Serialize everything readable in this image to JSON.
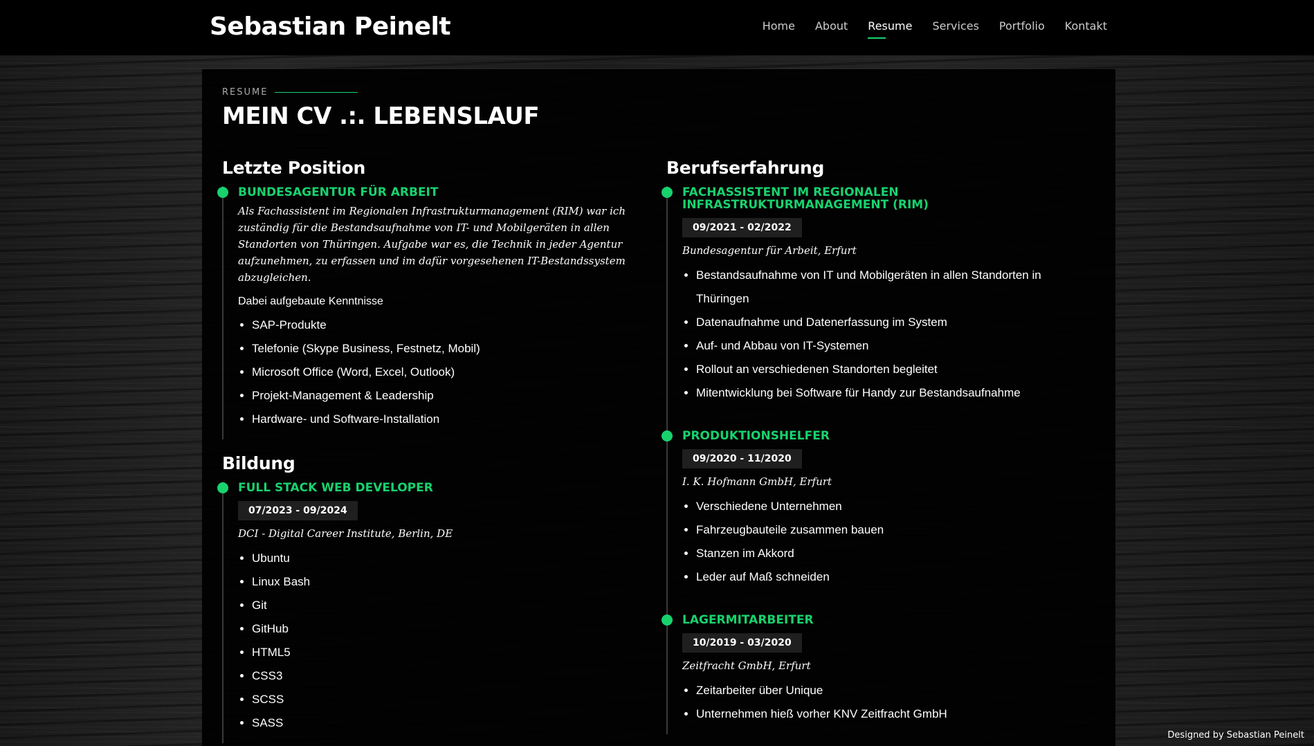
{
  "header": {
    "logo": "Sebastian Peinelt",
    "nav": [
      "Home",
      "About",
      "Resume",
      "Services",
      "Portfolio",
      "Kontakt"
    ],
    "active_nav": "Resume"
  },
  "section": {
    "kicker": "RESUME",
    "title": "MEIN CV .:. LEBENSLAUF"
  },
  "left": {
    "position_heading": "Letzte Position",
    "position": {
      "title": "BUNDESAGENTUR FÜR ARBEIT",
      "description": "Als Fachassistent im Regionalen Infrastrukturmanagement (RIM) war ich zuständig für die Bestandsaufnahme von IT- und Mobilgeräten in allen Standorten von Thüringen. Aufgabe war es, die Technik in jeder Agentur aufzunehmen, zu erfassen und im dafür vorgesehenen IT-Bestandssystem abzugleichen.",
      "skills_label": "Dabei aufgebaute Kenntnisse",
      "skills": [
        "SAP-Produkte",
        "Telefonie (Skype Business, Festnetz, Mobil)",
        "Microsoft Office (Word, Excel, Outlook)",
        "Projekt-Management & Leadership",
        "Hardware- und Software-Installation"
      ]
    },
    "education_heading": "Bildung",
    "education": {
      "title": "FULL STACK WEB DEVELOPER",
      "date": "07/2023 - 09/2024",
      "org": "DCI - Digital Career Institute, Berlin, DE",
      "items": [
        "Ubuntu",
        "Linux Bash",
        "Git",
        "GitHub",
        "HTML5",
        "CSS3",
        "SCSS",
        "SASS"
      ]
    }
  },
  "right": {
    "heading": "Berufserfahrung",
    "jobs": [
      {
        "title": "FACHASSISTENT IM REGIONALEN INFRASTRUKTURMANAGEMENT (RIM)",
        "date": "09/2021 - 02/2022",
        "org": "Bundesagentur für Arbeit, Erfurt",
        "items": [
          "Bestandsaufnahme von IT und Mobilgeräten in allen Standorten in Thüringen",
          "Datenaufnahme und Datenerfassung im System",
          "Auf- und Abbau von IT-Systemen",
          "Rollout an verschiedenen Standorten begleitet",
          "Mitentwicklung bei Software für Handy zur Bestandsaufnahme"
        ]
      },
      {
        "title": "PRODUKTIONSHELFER",
        "date": "09/2020 - 11/2020",
        "org": "I. K. Hofmann GmbH, Erfurt",
        "items": [
          "Verschiedene Unternehmen",
          "Fahrzeugbauteile zusammen bauen",
          "Stanzen im Akkord",
          "Leder auf Maß schneiden"
        ]
      },
      {
        "title": "LAGERMITARBEITER",
        "date": "10/2019 - 03/2020",
        "org": "Zeitfracht GmbH, Erfurt",
        "items": [
          "Zeitarbeiter über Unique",
          "Unternehmen hieß vorher KNV Zeitfracht GmbH"
        ]
      }
    ]
  },
  "footer": {
    "credit": "Designed by Sebastian Peinelt"
  },
  "colors": {
    "accent": "#18d26e",
    "panel": "#000000",
    "date_badge": "#1f1f1f"
  }
}
